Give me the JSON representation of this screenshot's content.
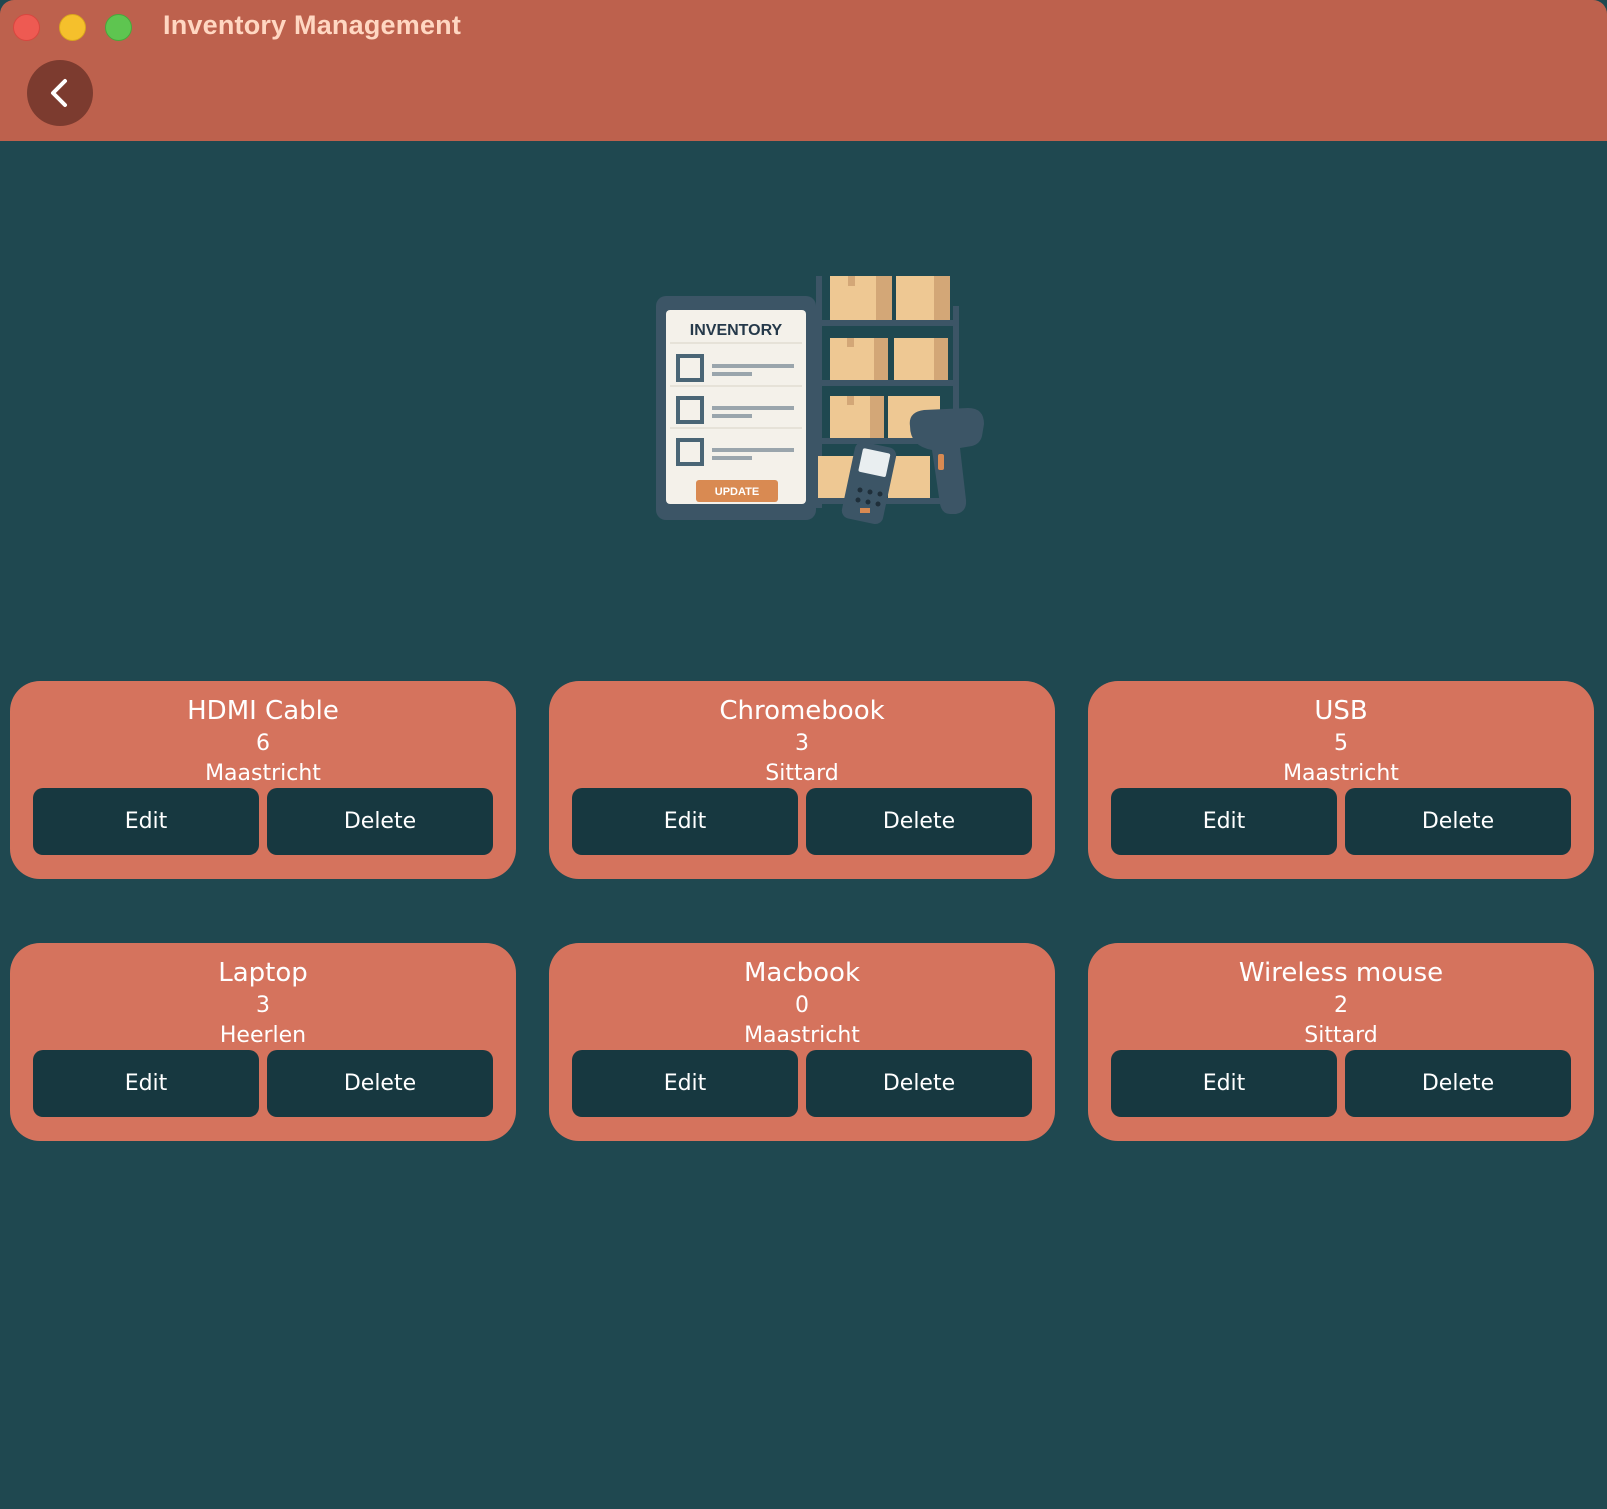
{
  "window": {
    "title": "Inventory Management"
  },
  "header": {
    "back_icon": "chevron-left-icon"
  },
  "illustration": {
    "label": "INVENTORY",
    "button_label": "UPDATE"
  },
  "items": [
    {
      "name": "HDMI Cable",
      "quantity": "6",
      "location": "Maastricht",
      "edit_label": "Edit",
      "delete_label": "Delete"
    },
    {
      "name": "Chromebook",
      "quantity": "3",
      "location": "Sittard",
      "edit_label": "Edit",
      "delete_label": "Delete"
    },
    {
      "name": "USB",
      "quantity": "5",
      "location": "Maastricht",
      "edit_label": "Edit",
      "delete_label": "Delete"
    },
    {
      "name": "Laptop",
      "quantity": "3",
      "location": "Heerlen",
      "edit_label": "Edit",
      "delete_label": "Delete"
    },
    {
      "name": "Macbook",
      "quantity": "0",
      "location": "Maastricht",
      "edit_label": "Edit",
      "delete_label": "Delete"
    },
    {
      "name": "Wireless mouse",
      "quantity": "2",
      "location": "Sittard",
      "edit_label": "Edit",
      "delete_label": "Delete"
    }
  ],
  "colors": {
    "header": "#bd614d",
    "background": "#1f4850",
    "card": "#d5735d",
    "button": "#173840",
    "title_text": "#ffd7c2"
  }
}
